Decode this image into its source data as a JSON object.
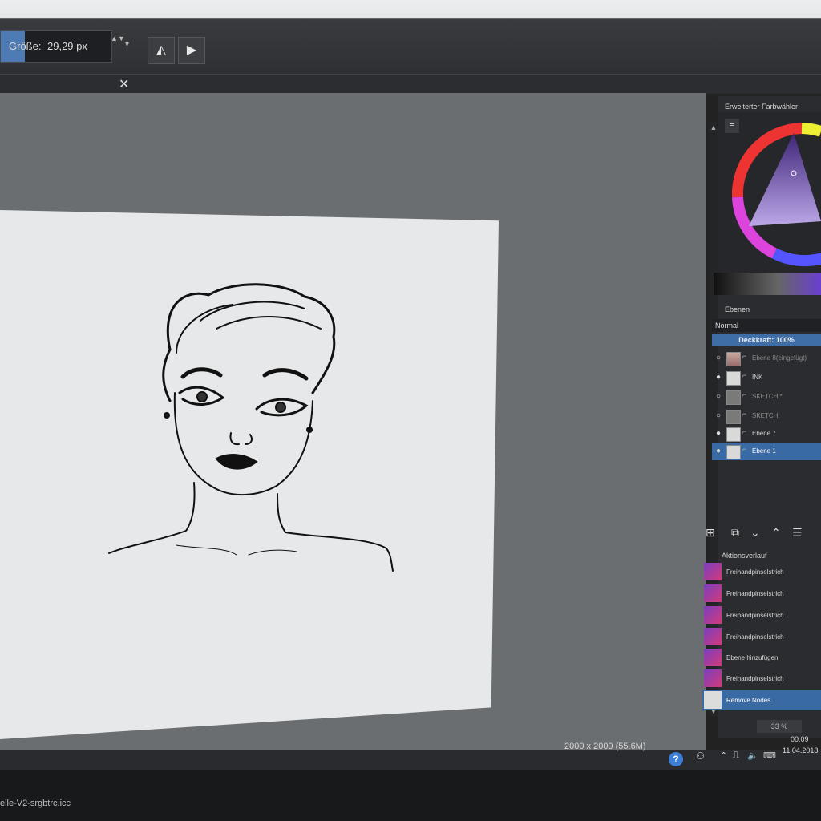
{
  "toolbar": {
    "size_label": "Größe:",
    "size_value": "29,29 px",
    "stepper_glyph": "▲▼",
    "dropdown_glyph": "▾",
    "mirror_h_glyph": "◭",
    "mirror_v_glyph": "▶"
  },
  "tab": {
    "close_glyph": "✕"
  },
  "docker": {
    "color_title": "Erweiterter Farbwähler",
    "layers_title": "Ebenen",
    "blend_mode": "Normal",
    "opacity": "Deckkraft:  100%",
    "layers": [
      {
        "name": "Ebene 8(eingefügt)",
        "visible": false
      },
      {
        "name": "INK",
        "visible": true
      },
      {
        "name": "SKETCH *",
        "visible": false
      },
      {
        "name": "SKETCH",
        "visible": false
      },
      {
        "name": "Ebene 7",
        "visible": true
      },
      {
        "name": "Ebene 1",
        "visible": true,
        "selected": true
      }
    ],
    "history_title": "Aktionsverlauf",
    "history": [
      "Freihandpinselstrich",
      "Freihandpinselstrich",
      "Freihandpinselstrich",
      "Freihandpinselstrich",
      "Ebene hinzufügen",
      "Freihandpinselstrich",
      "Remove Nodes"
    ]
  },
  "status": {
    "zoom": "33 %",
    "dimensions": "2000 x 2000 (55.6M)"
  },
  "taskbar": {
    "time": "00:09",
    "date": "11.04.2018",
    "filename": "elle-V2-srgbtrc.icc"
  },
  "colors": {
    "accent": "#3a6aa3",
    "canvas": "#e6e8ea",
    "workspace": "#6b6e70"
  }
}
